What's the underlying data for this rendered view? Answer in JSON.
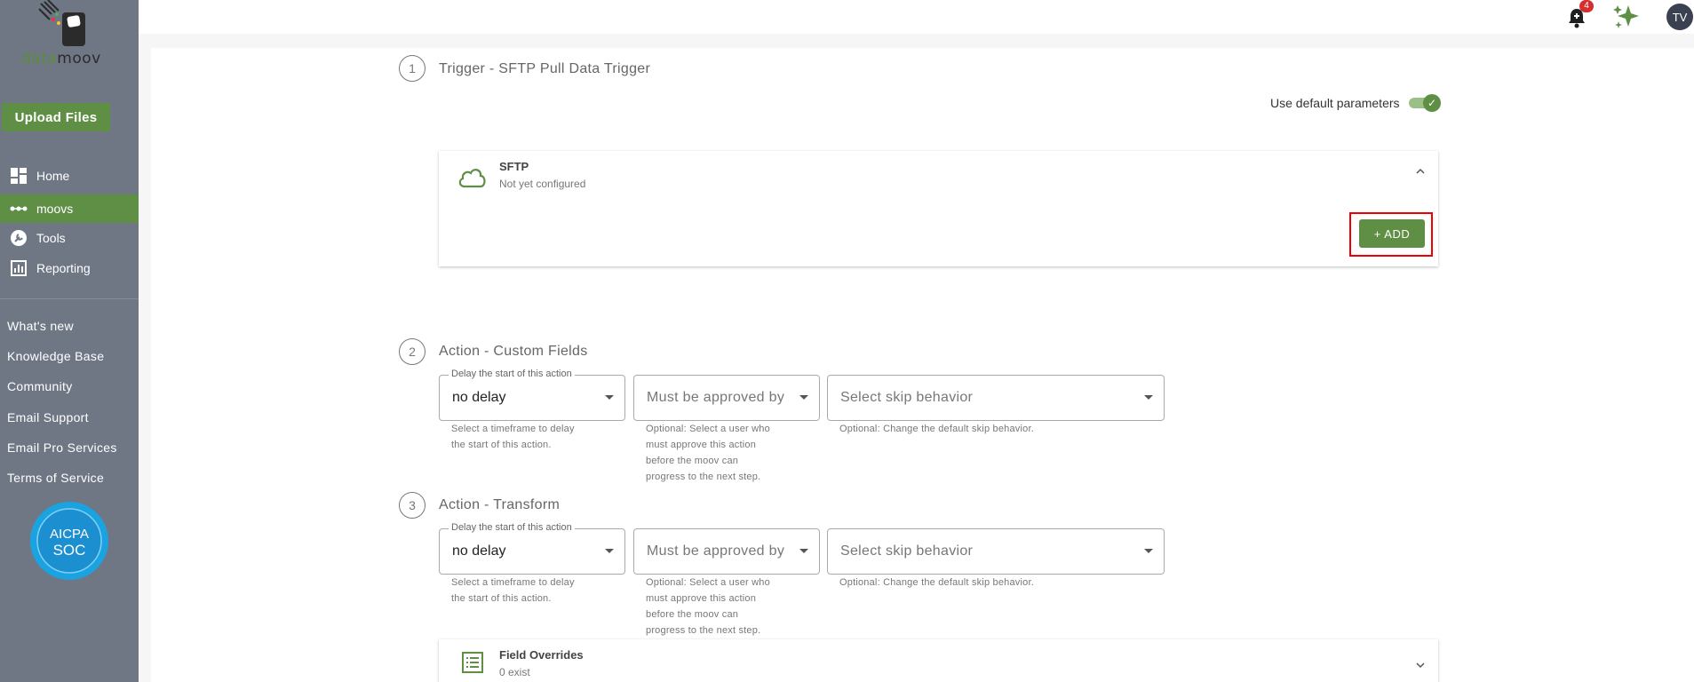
{
  "sidebar": {
    "logo": {
      "text_part1": "data",
      "text_part2": "moov"
    },
    "upload_label": "Upload Files",
    "nav": [
      {
        "label": "Home",
        "icon": "dashboard-icon"
      },
      {
        "label": "moovs",
        "icon": "flow-dots-icon"
      },
      {
        "label": "Tools",
        "icon": "wrench-icon"
      },
      {
        "label": "Reporting",
        "icon": "chart-icon"
      }
    ],
    "links": [
      "What's new",
      "Knowledge Base",
      "Community",
      "Email Support",
      "Email Pro Services",
      "Terms of Service"
    ],
    "badge": {
      "line1": "AICPA",
      "line2": "SOC"
    }
  },
  "topbar": {
    "notification_count": "4",
    "avatar_initials": "TV"
  },
  "steps": [
    {
      "number": "1",
      "title": "Trigger - SFTP Pull Data Trigger",
      "use_default_label": "Use default parameters",
      "use_default_on": true,
      "connector": {
        "title": "SFTP",
        "status": "Not yet configured",
        "add_label": "+ ADD"
      }
    },
    {
      "number": "2",
      "title": "Action - Custom Fields",
      "delay": {
        "legend": "Delay the start of this action",
        "value": "no delay",
        "helper": [
          "Select a timeframe to delay",
          "the start of this action."
        ]
      },
      "approver": {
        "value": "Must be approved by",
        "helper": [
          "Optional: Select a user who",
          "must approve this action",
          "before the moov can",
          "progress to the next step."
        ]
      },
      "skip": {
        "value": "Select skip behavior",
        "helper": "Optional: Change the default skip behavior."
      }
    },
    {
      "number": "3",
      "title": "Action - Transform",
      "delay": {
        "legend": "Delay the start of this action",
        "value": "no delay",
        "helper": [
          "Select a timeframe to delay",
          "the start of this action."
        ]
      },
      "approver": {
        "value": "Must be approved by",
        "helper": [
          "Optional: Select a user who",
          "must approve this action",
          "before the moov can",
          "progress to the next step."
        ]
      },
      "skip": {
        "value": "Select skip behavior",
        "helper": "Optional: Change the default skip behavior."
      },
      "overrides": {
        "title": "Field Overrides",
        "count": "0 exist"
      }
    }
  ],
  "colors": {
    "brand_green": "#5f8f45",
    "sidebar_bg": "#6f7785",
    "highlight": "#e00000"
  }
}
